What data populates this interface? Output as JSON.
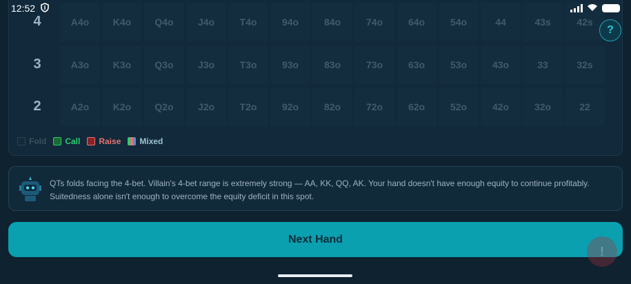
{
  "status_bar": {
    "time": "12:52",
    "shield_icon": "shield-icon",
    "signal_icon": "signal-icon",
    "wifi_icon": "wifi-icon",
    "battery_icon": "battery-icon"
  },
  "grid": {
    "rows": [
      {
        "rank": "4",
        "cells": [
          "A4o",
          "K4o",
          "Q4o",
          "J4o",
          "T4o",
          "94o",
          "84o",
          "74o",
          "64o",
          "54o",
          "44",
          "43s",
          "42s"
        ]
      },
      {
        "rank": "3",
        "cells": [
          "A3o",
          "K3o",
          "Q3o",
          "J3o",
          "T3o",
          "93o",
          "83o",
          "73o",
          "63o",
          "53o",
          "43o",
          "33",
          "32s"
        ]
      },
      {
        "rank": "2",
        "cells": [
          "A2o",
          "K2o",
          "Q2o",
          "J2o",
          "T2o",
          "92o",
          "82o",
          "72o",
          "62o",
          "52o",
          "42o",
          "32o",
          "22"
        ]
      }
    ],
    "help_label": "?"
  },
  "legend": {
    "fold": {
      "label": "Fold",
      "color": "#3a4f5e"
    },
    "call": {
      "label": "Call",
      "color": "#2ecc71"
    },
    "raise": {
      "label": "Raise",
      "color": "#e57373"
    },
    "mixed": {
      "label": "Mixed",
      "color": "#9cc3d0"
    }
  },
  "explanation": {
    "icon": "robot-icon",
    "text": "QTs folds facing the 4-bet. Villain's 4-bet range is extremely strong — AA, KK, QQ, AK. Your hand doesn't have enough equity to continue profitably. Suitedness alone isn't enough to overcome the equity deficit in this spot."
  },
  "actions": {
    "next_label": "Next Hand",
    "fab_label": "!"
  },
  "colors": {
    "accent": "#0aa0b0",
    "background": "#0f2230",
    "panel": "#11293a"
  }
}
